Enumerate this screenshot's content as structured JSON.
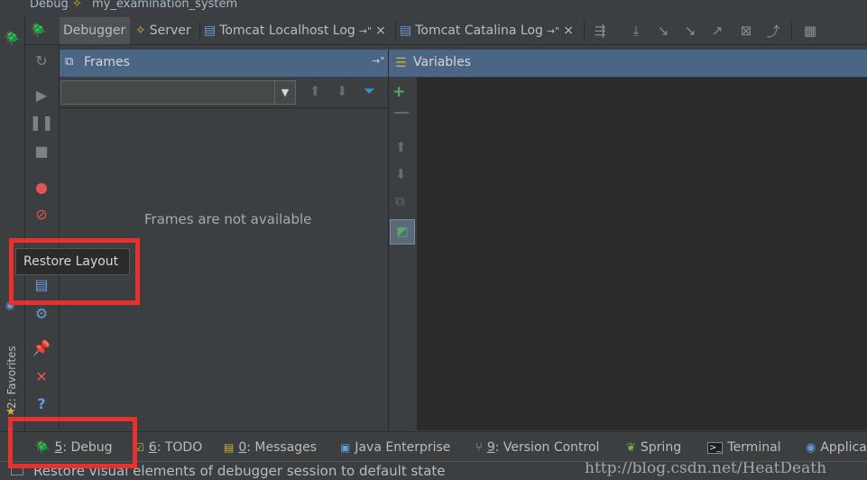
{
  "window": {
    "title_prefix": "Debug",
    "config_name": "my_examination_system"
  },
  "tabs": [
    {
      "label": "Debugger",
      "active": true
    },
    {
      "label": "Server",
      "active": false
    },
    {
      "label": "Tomcat Localhost Log",
      "active": false,
      "pin": "→\"",
      "close": "×"
    },
    {
      "label": "Tomcat Catalina Log",
      "active": false,
      "pin": "→\"",
      "close": "×"
    }
  ],
  "frames": {
    "title": "Frames",
    "empty_message": "Frames are not available",
    "pin": "→\""
  },
  "variables": {
    "title": "Variables"
  },
  "tooltip": {
    "text": "Restore Layout"
  },
  "side_stripe": {
    "favorites_label": "2: Favorites"
  },
  "bottom_tabs": [
    {
      "mnemonic": "5",
      "label": ": Debug",
      "icon": "bug-icon"
    },
    {
      "mnemonic": "6",
      "label": ": TODO",
      "icon": "todo-icon"
    },
    {
      "mnemonic": "0",
      "label": ": Messages",
      "icon": "messages-icon"
    },
    {
      "mnemonic": "",
      "label": "Java Enterprise",
      "icon": "java-enterprise-icon"
    },
    {
      "mnemonic": "9",
      "label": ": Version Control",
      "icon": "version-control-icon"
    },
    {
      "mnemonic": "",
      "label": "Spring",
      "icon": "spring-leaf-icon"
    },
    {
      "mnemonic": "",
      "label": "Terminal",
      "icon": "terminal-icon"
    },
    {
      "mnemonic": "",
      "label": "Applica",
      "icon": "application-servers-icon"
    }
  ],
  "status": {
    "text": "Restore visual elements of debugger session to default state"
  },
  "watermark": "http://blog.csdn.net/HeatDeath",
  "colors": {
    "background": "#3c3f41",
    "panel_header": "#4b6584",
    "annotation_red": "#e8302f",
    "bug_green": "#59a869"
  }
}
